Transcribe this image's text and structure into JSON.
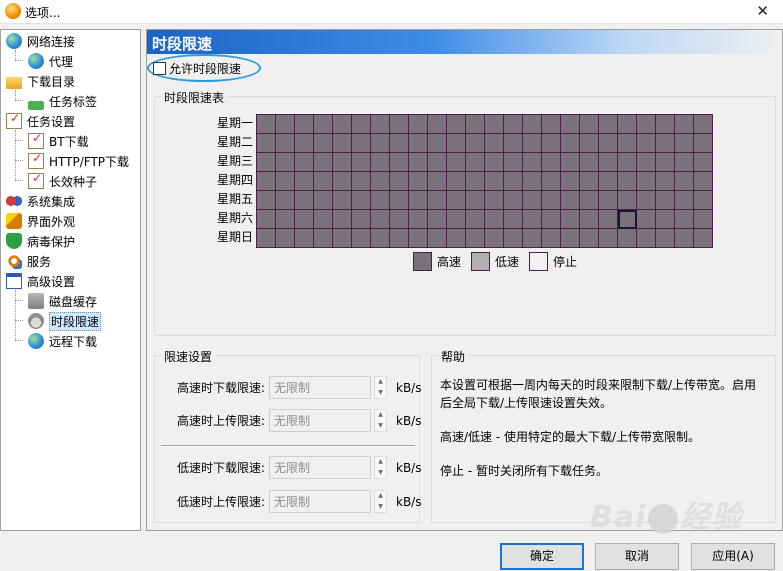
{
  "window": {
    "title": "选项...",
    "close_glyph": "✕"
  },
  "sidebar": {
    "items": [
      {
        "label": "网络连接",
        "icon": "globe-icon"
      },
      {
        "label": "代理",
        "icon": "proxy-globe-icon"
      },
      {
        "label": "下载目录",
        "icon": "folder-icon"
      },
      {
        "label": "任务标签",
        "icon": "tag-icon"
      },
      {
        "label": "任务设置",
        "icon": "checklist-icon"
      },
      {
        "label": "BT下载",
        "icon": "checklist-icon"
      },
      {
        "label": "HTTP/FTP下载",
        "icon": "checklist-icon"
      },
      {
        "label": "长效种子",
        "icon": "checklist-icon"
      },
      {
        "label": "系统集成",
        "icon": "people-icon"
      },
      {
        "label": "界面外观",
        "icon": "brush-icon"
      },
      {
        "label": "病毒保护",
        "icon": "shield-icon"
      },
      {
        "label": "服务",
        "icon": "service-icon"
      },
      {
        "label": "高级设置",
        "icon": "window-icon"
      },
      {
        "label": "磁盘缓存",
        "icon": "disk-icon"
      },
      {
        "label": "时段限速",
        "icon": "speed-icon",
        "selected": true
      },
      {
        "label": "远程下载",
        "icon": "remote-globe-icon"
      }
    ]
  },
  "main": {
    "banner_title": "时段限速",
    "enable_checkbox": {
      "label": "允许时段限速",
      "checked": false
    },
    "schedule": {
      "group_title": "时段限速表",
      "days": [
        "星期一",
        "星期二",
        "星期三",
        "星期四",
        "星期五",
        "星期六",
        "星期日"
      ],
      "columns": 24,
      "cell_color": "#7a717a",
      "legend": [
        {
          "label": "高速",
          "color": "#7a717a"
        },
        {
          "label": "低速",
          "color": "#b3aeb3"
        },
        {
          "label": "停止",
          "color": "#f4f0f4"
        }
      ]
    },
    "limits": {
      "group_title": "限速设置",
      "fields": [
        {
          "label": "高速时下载限速:",
          "value": "无限制",
          "unit": "kB/s"
        },
        {
          "label": "高速时上传限速:",
          "value": "无限制",
          "unit": "kB/s"
        },
        {
          "label": "低速时下载限速:",
          "value": "无限制",
          "unit": "kB/s"
        },
        {
          "label": "低速时上传限速:",
          "value": "无限制",
          "unit": "kB/s"
        }
      ]
    },
    "help": {
      "group_title": "帮助",
      "paragraphs": [
        "本设置可根据一周内每天的时段来限制下载/上传带宽。启用后全局下载/上传限速设置失效。",
        "高速/低速 - 使用特定的最大下载/上传带宽限制。",
        "停止 - 暂时关闭所有下载任务。"
      ]
    }
  },
  "buttons": {
    "ok": "确定",
    "cancel": "取消",
    "apply": "应用(A)"
  },
  "watermark": {
    "text_a": "Bai",
    "text_b": "经验"
  }
}
